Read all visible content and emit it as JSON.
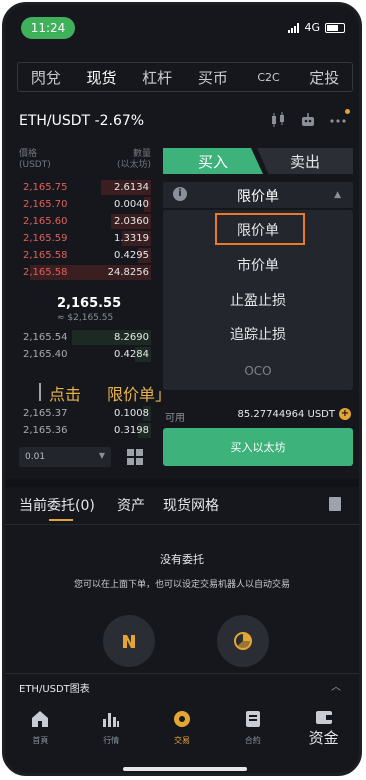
{
  "status": {
    "time": "11:24",
    "network": "4G"
  },
  "top_tabs": [
    {
      "label": "閃兌"
    },
    {
      "label": "现货"
    },
    {
      "label": "杠杆"
    },
    {
      "label": "买币"
    },
    {
      "label": "C2C"
    },
    {
      "label": "定投"
    }
  ],
  "pair": {
    "symbol": "ETH/USDT",
    "change": "-2.67%"
  },
  "orderbook": {
    "price_header_1": "價格",
    "price_header_2": "(USDT)",
    "qty_header_1": "數量",
    "qty_header_2": "(以太坊)",
    "asks": [
      {
        "price": "2,165.75",
        "qty": "2.6134",
        "depth": 0.38
      },
      {
        "price": "2,165.70",
        "qty": "0.0040",
        "depth": 0.05
      },
      {
        "price": "2,165.60",
        "qty": "2.0360",
        "depth": 0.3
      },
      {
        "price": "2,165.59",
        "qty": "1.3319",
        "depth": 0.22
      },
      {
        "price": "2,165.58",
        "qty": "0.4295",
        "depth": 0.1
      },
      {
        "price": "2,165.58",
        "qty": "24.8256",
        "depth": 0.92
      }
    ],
    "last_price": "2,165.55",
    "last_fiat": "≈ $2,165.55",
    "bids": [
      {
        "price": "2,165.54",
        "qty": "8.2690",
        "depth": 0.6
      },
      {
        "price": "2,165.40",
        "qty": "0.4284",
        "depth": 0.12
      },
      {
        "price": "2,165.37",
        "qty": "0.1008",
        "depth": 0.06
      },
      {
        "price": "2,165.36",
        "qty": "0.3198",
        "depth": 0.1
      }
    ],
    "depth_value": "0.01"
  },
  "trade_panel": {
    "buy_label": "买入",
    "sell_label": "卖出",
    "order_type": "限价单",
    "dropdown_items": [
      "限价单",
      "市价单",
      "止盈止损",
      "追踪止损",
      "OCO"
    ],
    "available_label": "可用",
    "available_value": "85.27744964 USDT",
    "buy_button": "买入以太坊"
  },
  "annotation": {
    "part1": "点击",
    "part2": "限价单」"
  },
  "orders": {
    "tabs": [
      "当前委托(0)",
      "资产",
      "现货网格"
    ],
    "empty_title": "没有委托",
    "empty_sub": "您可以在上面下单，也可以设定交易机器人以自动交易"
  },
  "chart_bar": {
    "title": "ETH/USDT图表"
  },
  "bottom_nav": [
    {
      "label": "首頁",
      "icon": "home-icon"
    },
    {
      "label": "行情",
      "icon": "markets-icon"
    },
    {
      "label": "交易",
      "icon": "trade-icon"
    },
    {
      "label": "合約",
      "icon": "futures-icon"
    },
    {
      "label": "资金",
      "icon": "wallet-icon"
    }
  ],
  "colors": {
    "buy": "#3db27a",
    "sell": "#e0605a",
    "accent": "#e4a534",
    "highlight": "#e87a2a"
  }
}
